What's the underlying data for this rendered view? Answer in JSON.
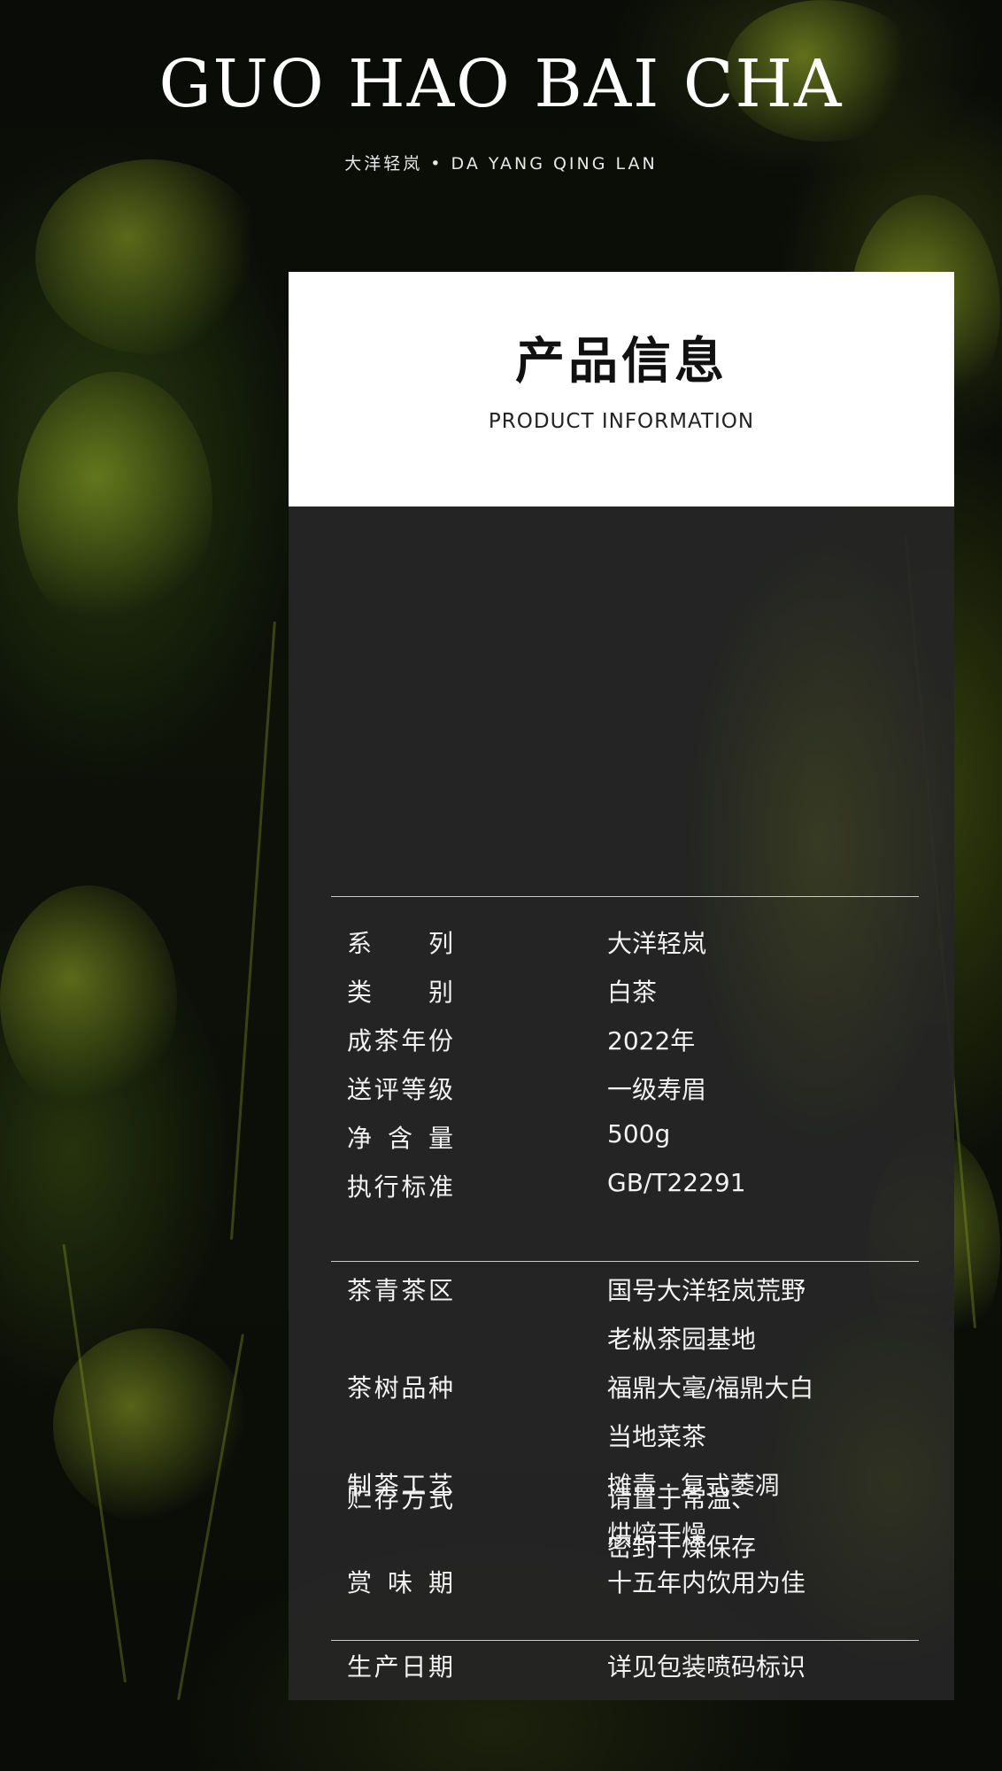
{
  "header": {
    "title": "GUO HAO BAI CHA",
    "subtitle": "大洋轻岚 • DA YANG QING LAN"
  },
  "card": {
    "title_cn": "产品信息",
    "title_en": "PRODUCT INFORMATION"
  },
  "section1": [
    {
      "label": "系列",
      "value": "大洋轻岚"
    },
    {
      "label": "类别",
      "value": "白茶"
    },
    {
      "label": "成茶年份",
      "value": "2022年"
    },
    {
      "label": "送评等级",
      "value": "一级寿眉"
    },
    {
      "label": "净含量",
      "value": "500g"
    },
    {
      "label": "执行标准",
      "value": "GB/T22291"
    }
  ],
  "section2": [
    {
      "label": "茶青茶区",
      "value": "国号大洋轻岚荒野"
    },
    {
      "label": "",
      "value": "老枞茶园基地"
    },
    {
      "label": "茶树品种",
      "value": "福鼎大毫/福鼎大白"
    },
    {
      "label": "",
      "value": "当地菜茶"
    },
    {
      "label": "制茶工艺",
      "value": "摊青 · 复式萎凋"
    },
    {
      "label": "",
      "value": "烘焙干燥"
    },
    {
      "label": "赏味期",
      "value": "十五年内饮用为佳"
    }
  ],
  "section3": [
    {
      "label": "生产日期",
      "value": "详见包装喷码标识"
    },
    {
      "label": "贮存方式",
      "value": "请置于常温、"
    },
    {
      "label": "",
      "value": "密封干燥保存"
    }
  ]
}
